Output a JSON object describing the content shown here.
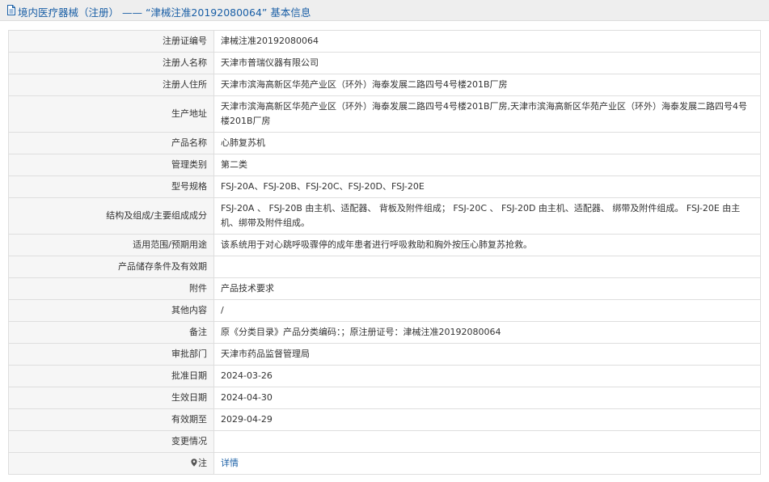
{
  "header": {
    "title": "境内医疗器械（注册） —— “津械注准20192080064” 基本信息"
  },
  "rows": [
    {
      "label": "注册证编号",
      "value": "津械注准20192080064"
    },
    {
      "label": "注册人名称",
      "value": "天津市普瑞仪器有限公司"
    },
    {
      "label": "注册人住所",
      "value": "天津市滨海高新区华苑产业区（环外）海泰发展二路四号4号楼201B厂房"
    },
    {
      "label": "生产地址",
      "value": "天津市滨海高新区华苑产业区（环外）海泰发展二路四号4号楼201B厂房,天津市滨海高新区华苑产业区（环外）海泰发展二路四号4号楼201B厂房"
    },
    {
      "label": "产品名称",
      "value": "心肺复苏机"
    },
    {
      "label": "管理类别",
      "value": "第二类"
    },
    {
      "label": "型号规格",
      "value": "FSJ-20A、FSJ-20B、FSJ-20C、FSJ-20D、FSJ-20E"
    },
    {
      "label": "结构及组成/主要组成成分",
      "value": "FSJ-20A 、 FSJ-20B 由主机、适配器、 背板及附件组成； FSJ-20C 、 FSJ-20D 由主机、适配器、 绑带及附件组成。 FSJ-20E 由主机、绑带及附件组成。"
    },
    {
      "label": "适用范围/预期用途",
      "value": "该系统用于对心跳呼吸骤停的成年患者进行呼吸救助和胸外按压心肺复苏抢救。"
    },
    {
      "label": "产品储存条件及有效期",
      "value": ""
    },
    {
      "label": "附件",
      "value": "产品技术要求"
    },
    {
      "label": "其他内容",
      "value": "/"
    },
    {
      "label": "备注",
      "value": "原《分类目录》产品分类编码：；原注册证号：津械注准20192080064"
    },
    {
      "label": "审批部门",
      "value": "天津市药品监督管理局"
    },
    {
      "label": "批准日期",
      "value": "2024-03-26"
    },
    {
      "label": "生效日期",
      "value": "2024-04-30"
    },
    {
      "label": "有效期至",
      "value": "2029-04-29"
    },
    {
      "label": "变更情况",
      "value": ""
    }
  ],
  "note_row": {
    "label": "注",
    "link_text": "详情"
  },
  "colors": {
    "title": "#1a5fa6",
    "link": "#1a5fa6",
    "label_bg": "#f6f6f6",
    "border": "#dedede",
    "header_bg": "#eeeeee"
  },
  "icons": {
    "title_icon": "document-icon",
    "note_icon": "map-pin-icon"
  }
}
